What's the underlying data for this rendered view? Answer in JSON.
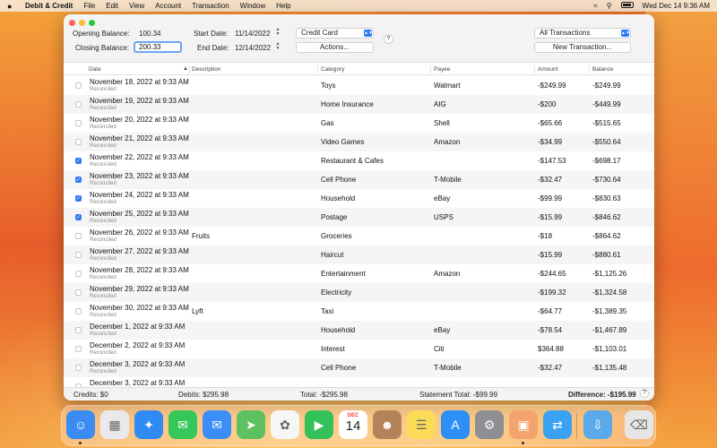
{
  "menubar": {
    "app_name": "Debit & Credit",
    "items": [
      "File",
      "Edit",
      "View",
      "Account",
      "Transaction",
      "Window",
      "Help"
    ],
    "datetime": "Wed Dec 14  9:36 AM"
  },
  "toolbar": {
    "opening_label": "Opening Balance:",
    "opening_value": "100.34",
    "closing_label": "Closing Balance:",
    "closing_value": "200.33",
    "start_label": "Start Date:",
    "start_value": "11/14/2022",
    "end_label": "End Date:",
    "end_value": "12/14/2022",
    "account_select": "Credit Card",
    "actions_label": "Actions...",
    "help_label": "?",
    "filter_select": "All Transactions",
    "new_transaction_label": "New Transaction..."
  },
  "table": {
    "headers": {
      "date": "Date",
      "description": "Description",
      "category": "Category",
      "payee": "Payee",
      "amount": "Amount",
      "balance": "Balance"
    },
    "rows": [
      {
        "checked": false,
        "date": "November 18, 2022 at 9:33 AM",
        "status": "Reconciled",
        "description": "",
        "category": "Toys",
        "payee": "Walmart",
        "amount": "-$249.99",
        "balance": "-$249.99"
      },
      {
        "checked": false,
        "date": "November 19, 2022 at 9:33 AM",
        "status": "Reconciled",
        "description": "",
        "category": "Home Insurance",
        "payee": "AIG",
        "amount": "-$200",
        "balance": "-$449.99"
      },
      {
        "checked": false,
        "date": "November 20, 2022 at 9:33 AM",
        "status": "Reconciled",
        "description": "",
        "category": "Gas",
        "payee": "Shell",
        "amount": "-$65.66",
        "balance": "-$515.65"
      },
      {
        "checked": false,
        "date": "November 21, 2022 at 9:33 AM",
        "status": "Reconciled",
        "description": "",
        "category": "Video Games",
        "payee": "Amazon",
        "amount": "-$34.99",
        "balance": "-$550.64"
      },
      {
        "checked": true,
        "date": "November 22, 2022 at 9:33 AM",
        "status": "Reconciled",
        "description": "",
        "category": "Restaurant & Cafes",
        "payee": "",
        "amount": "-$147.53",
        "balance": "-$698.17"
      },
      {
        "checked": true,
        "date": "November 23, 2022 at 9:33 AM",
        "status": "Reconciled",
        "description": "",
        "category": "Cell Phone",
        "payee": "T-Mobile",
        "amount": "-$32.47",
        "balance": "-$730.64"
      },
      {
        "checked": true,
        "date": "November 24, 2022 at 9:33 AM",
        "status": "Reconciled",
        "description": "",
        "category": "Household",
        "payee": "eBay",
        "amount": "-$99.99",
        "balance": "-$830.63"
      },
      {
        "checked": true,
        "date": "November 25, 2022 at 9:33 AM",
        "status": "Reconciled",
        "description": "",
        "category": "Postage",
        "payee": "USPS",
        "amount": "-$15.99",
        "balance": "-$846.62"
      },
      {
        "checked": false,
        "date": "November 26, 2022 at 9:33 AM",
        "status": "Reconciled",
        "description": "Fruits",
        "category": "Groceries",
        "payee": "",
        "amount": "-$18",
        "balance": "-$864.62"
      },
      {
        "checked": false,
        "date": "November 27, 2022 at 9:33 AM",
        "status": "Reconciled",
        "description": "",
        "category": "Haircut",
        "payee": "",
        "amount": "-$15.99",
        "balance": "-$880.61"
      },
      {
        "checked": false,
        "date": "November 28, 2022 at 9:33 AM",
        "status": "Reconciled",
        "description": "",
        "category": "Entertainment",
        "payee": "Amazon",
        "amount": "-$244.65",
        "balance": "-$1,125.26"
      },
      {
        "checked": false,
        "date": "November 29, 2022 at 9:33 AM",
        "status": "Reconciled",
        "description": "",
        "category": "Electricity",
        "payee": "",
        "amount": "-$199.32",
        "balance": "-$1,324.58"
      },
      {
        "checked": false,
        "date": "November 30, 2022 at 9:33 AM",
        "status": "Reconciled",
        "description": "Lyft",
        "category": "Taxi",
        "payee": "",
        "amount": "-$64.77",
        "balance": "-$1,389.35"
      },
      {
        "checked": false,
        "date": "December 1, 2022 at 9:33 AM",
        "status": "Reconciled",
        "description": "",
        "category": "Household",
        "payee": "eBay",
        "amount": "-$78.54",
        "balance": "-$1,467.89"
      },
      {
        "checked": false,
        "date": "December 2, 2022 at 9:33 AM",
        "status": "Reconciled",
        "description": "",
        "category": "Interest",
        "payee": "Citi",
        "amount": "$364.88",
        "balance": "-$1,103.01"
      },
      {
        "checked": false,
        "date": "December 3, 2022 at 9:33 AM",
        "status": "Reconciled",
        "description": "",
        "category": "Cell Phone",
        "payee": "T-Mobile",
        "amount": "-$32.47",
        "balance": "-$1,135.48"
      },
      {
        "checked": false,
        "date": "December 3, 2022 at 9:33 AM",
        "status": "",
        "description": "",
        "category": "",
        "payee": "",
        "amount": "",
        "balance": ""
      }
    ]
  },
  "statusbar": {
    "credits": "Credits: $0",
    "debits": "Debits: $295.98",
    "total": "Total: -$295.98",
    "statement_total": "Statement Total: -$99.99",
    "difference": "Difference: -$195.99",
    "help_label": "?"
  },
  "dock": {
    "calendar_month": "DEC",
    "calendar_day": "14",
    "icons": [
      {
        "name": "finder-icon",
        "color": "#3b8cf2"
      },
      {
        "name": "launchpad-icon",
        "color": "#e9e9ec"
      },
      {
        "name": "safari-icon",
        "color": "#2f8bf3"
      },
      {
        "name": "messages-icon",
        "color": "#35c759"
      },
      {
        "name": "mail-icon",
        "color": "#3a8ef6"
      },
      {
        "name": "maps-icon",
        "color": "#5fc060"
      },
      {
        "name": "photos-icon",
        "color": "#f6f6f6"
      },
      {
        "name": "facetime-icon",
        "color": "#34c159"
      },
      {
        "name": "calendar-icon",
        "color": "#ffffff"
      },
      {
        "name": "contacts-icon",
        "color": "#b5835a"
      },
      {
        "name": "notes-icon",
        "color": "#fbdc59"
      },
      {
        "name": "app-store-icon",
        "color": "#2d8ef6"
      },
      {
        "name": "system-settings-icon",
        "color": "#8e8e93"
      },
      {
        "name": "debit-credit-app-icon",
        "color": "#f3a36b"
      },
      {
        "name": "screen-sharing-icon",
        "color": "#3aa2f2"
      },
      {
        "name": "downloads-folder-icon",
        "color": "#5aa9e8"
      },
      {
        "name": "trash-icon",
        "color": "#e6e6e6"
      }
    ]
  }
}
